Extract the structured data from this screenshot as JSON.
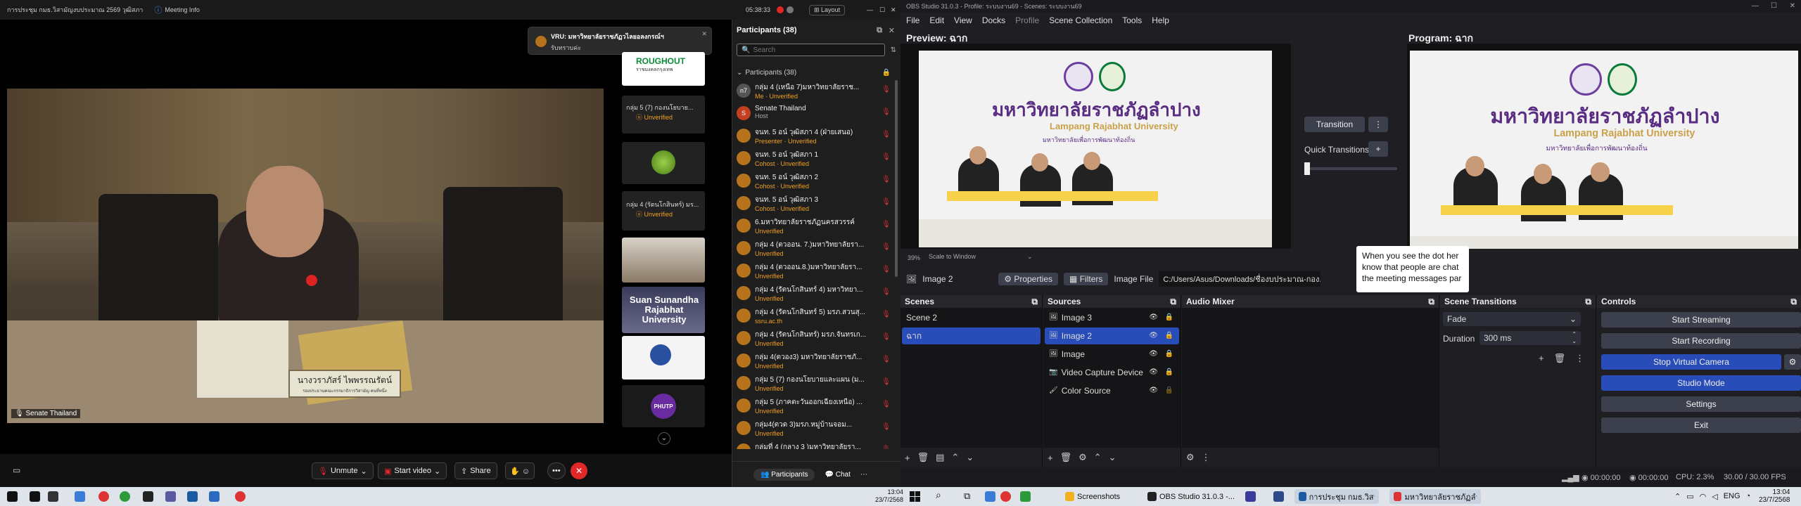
{
  "zoom": {
    "topbar": {
      "meeting_title": "การประชุม กมธ.วิสามัญงบประมาณ 2569 วุฒิสภา",
      "meeting_info": "Meeting Info",
      "timer": "05:38:33",
      "layout": "Layout"
    },
    "notification": {
      "title": "VRU: มหาวิทยาลัยราชภัฏวไลยอลงกรณ์ฯ",
      "body": "รับทราบค่ะ"
    },
    "speaker": {
      "nameplate": "นางวราภัสร์ ไพพรรณรัตน์",
      "nameplate_sub": "รองประธานคณะกรรมาธิการวิสามัญ คนที่หนึ่ง",
      "label": "Senate Thailand"
    },
    "strip": [
      {
        "name": "",
        "status": "",
        "caption": "ROUGHOUT",
        "sub": "ราชมงคลกรุงเทพ"
      },
      {
        "name": "กลุ่ม 5 (7) กองนโยบาย...",
        "status": "Unverified"
      },
      {
        "name": "",
        "status": ""
      },
      {
        "name": "กลุ่ม 4 (รัตนโกสินทร์) มร...",
        "status": "Unverified"
      },
      {
        "name": "",
        "status": ""
      },
      {
        "name": "Suan Sunandha Rajabhat University",
        "status": ""
      },
      {
        "name": "",
        "status": ""
      },
      {
        "name": "PHUTP",
        "status": ""
      }
    ],
    "participants": {
      "header": "Participants (38)",
      "search_placeholder": "Search",
      "section": "Participants (38)",
      "list": [
        {
          "name": "กลุ่ม 4 (เหนือ 7)มหาวิทยาลัยราช...",
          "status": "Me · Unverified",
          "avatar": "n7"
        },
        {
          "name": "Senate Thailand",
          "status": "Host",
          "avatar": "S"
        },
        {
          "name": "จนท. 5 อน์ วุฒิสภา 4 (ฝ่ายเสนอ)",
          "status": "Presenter · Unverified",
          "avatar": ""
        },
        {
          "name": "จนท. 5 อน์ วุฒิสภา 1",
          "status": "Cohost · Unverified",
          "avatar": ""
        },
        {
          "name": "จนท. 5 อน์ วุฒิสภา 2",
          "status": "Cohost · Unverified",
          "avatar": ""
        },
        {
          "name": "จนท. 5 อน์ วุฒิสภา 3",
          "status": "Cohost · Unverified",
          "avatar": ""
        },
        {
          "name": "6.มหาวิทยาลัยราชภัฏนครสวรรค์",
          "status": "Unverified",
          "avatar": ""
        },
        {
          "name": "กลุ่ม 4 (ตวออน. 7.)มหาวิทยาลัยรา...",
          "status": "Unverified",
          "avatar": ""
        },
        {
          "name": "กลุ่ม 4 (ตวออน.8.)มหาวิทยาลัยรา...",
          "status": "Unverified",
          "avatar": ""
        },
        {
          "name": "กลุ่ม 4 (รัตนโกสินทร์ 4) มหาวิทยา...",
          "status": "Unverified",
          "avatar": ""
        },
        {
          "name": "กลุ่ม 4 (รัตนโกสินทร์ 5) มรภ.สวนสุ...",
          "status": "ssru.ac.th",
          "avatar": ""
        },
        {
          "name": "กลุ่ม 4 (รัตนโกสินทร์) มรภ.จันทรเก...",
          "status": "Unverified",
          "avatar": ""
        },
        {
          "name": "กลุ่ม 4(ตวอง3) มหาวิทยาลัยราชภั...",
          "status": "Unverified",
          "avatar": ""
        },
        {
          "name": "กลุ่ม 5 (7) กองนโยบายและแผน (ม...",
          "status": "Unverified",
          "avatar": ""
        },
        {
          "name": "กลุ่ม 5 (ภาคตะวันออกเฉียงเหนือ) ...",
          "status": "Unverified",
          "avatar": ""
        },
        {
          "name": "กลุ่ม4(ตวด 3)มรภ.หมู่บ้านจอม...",
          "status": "Unverified",
          "avatar": ""
        },
        {
          "name": "กลุ่มที่ 4 (กลาง 3 )มหาวิทยาลัยรา...",
          "status": "",
          "avatar": ""
        }
      ],
      "tab_participants": "Participants",
      "tab_chat": "Chat"
    },
    "toolbar": {
      "unmute": "Unmute",
      "start_video": "Start video",
      "share": "Share"
    },
    "self_label": "Senate Thailand"
  },
  "obs": {
    "title": "OBS Studio 31.0.3 - Profile: ระบบงาน69 - Scenes: ระบบงาน69",
    "menu": [
      "File",
      "Edit",
      "View",
      "Docks",
      "Profile",
      "Scene Collection",
      "Tools",
      "Help"
    ],
    "preview_label": "Preview: ฉาก",
    "program_label": "Program: ฉาก",
    "slide": {
      "title_th": "มหาวิทยาลัยราชภัฏลำปาง",
      "title_en": "Lampang Rajabhat University",
      "subtitle": "มหาวิทยาลัยเพื่อการพัฒนาท้องถิ่น"
    },
    "zoom_pct": "39%",
    "scale": "Scale to Window",
    "transition": "Transition",
    "quick_transitions": "Quick Transitions",
    "tooltip": "When you see the dot here, know that people are chatting in the meeting messages panel.",
    "tooltip_lines": [
      "When you see the dot her",
      "know that people are chat",
      "the meeting messages par"
    ],
    "source_bar": {
      "name": "Image 2",
      "properties": "Properties",
      "filters": "Filters",
      "image_file_label": "Image File",
      "image_file": "C:/Users/Asus/Downloads/ชื่องบประมาณ-กอง..."
    },
    "scenes": {
      "title": "Scenes",
      "items": [
        "Scene 2",
        "ฉาก"
      ]
    },
    "sources": {
      "title": "Sources",
      "items": [
        "Image 3",
        "Image 2",
        "Image",
        "Video Capture Device",
        "Color Source"
      ]
    },
    "audio": {
      "title": "Audio Mixer"
    },
    "transitions": {
      "title": "Scene Transitions",
      "type": "Fade",
      "duration_label": "Duration",
      "duration": "300 ms"
    },
    "controls": {
      "title": "Controls",
      "start_streaming": "Start Streaming",
      "start_recording": "Start Recording",
      "stop_virtual_camera": "Stop Virtual Camera",
      "studio_mode": "Studio Mode",
      "settings": "Settings",
      "exit": "Exit"
    },
    "status": {
      "rec_time": "00:00:00",
      "stream_time": "00:00:00",
      "cpu": "CPU: 2.3%",
      "fps": "30.00 / 30.00 FPS"
    }
  },
  "taskbar": {
    "left_time": "13:04",
    "left_date": "23/7/2568",
    "apps": [
      "Screenshots",
      "OBS Studio 31.0.3 -...",
      "การประชุม กมธ.วิสามั...",
      "มหาวิทยาลัยราชภัฏลำ..."
    ],
    "lang": "ENG",
    "time": "13:04",
    "date": "23/7/2568"
  },
  "colors": {
    "obs_blue": "#284cb8",
    "zoom_red": "#e02828",
    "unverified": "#f0a020"
  }
}
